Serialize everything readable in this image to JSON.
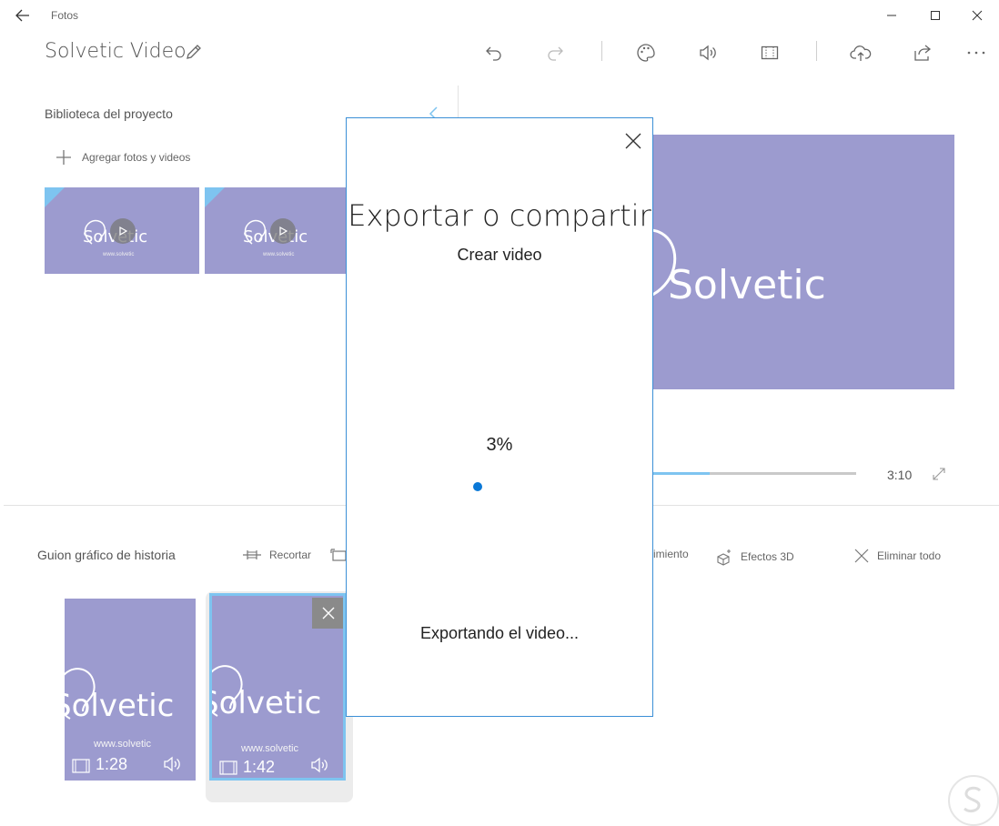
{
  "window": {
    "app_title": "Fotos",
    "back_icon": "arrow-left-icon",
    "minimize_icon": "minimize-icon",
    "maximize_icon": "maximize-icon",
    "close_icon": "close-icon"
  },
  "header": {
    "project_title": "Solvetic Video",
    "toolbar_icons": [
      "undo-icon",
      "redo-icon",
      "palette-icon",
      "volume-icon",
      "aspect-ratio-icon",
      "upload-cloud-icon",
      "share-icon",
      "more-icon"
    ]
  },
  "library": {
    "title": "Biblioteca del proyecto",
    "add_label": "Agregar fotos y videos",
    "items": [
      {
        "logo": "Solvetic",
        "url": "www.solvetic"
      },
      {
        "logo": "Solvetic",
        "url": "www.solvetic"
      }
    ]
  },
  "preview": {
    "logo": "Solvetic",
    "duration": "3:10",
    "progress": 0.28
  },
  "storyboard": {
    "title": "Guion gráfico de historia",
    "tools": {
      "trim": "Recortar",
      "motion": "imiento",
      "effects3d": "Efectos 3D",
      "delete_all": "Eliminar todo"
    },
    "clips": [
      {
        "logo": "Solvetic",
        "url": "www.solvetic",
        "duration": "1:28",
        "selected": false
      },
      {
        "logo": "Solvetic",
        "url": "www.solvetic",
        "duration": "1:42",
        "selected": true
      }
    ]
  },
  "dialog": {
    "title": "Exportar o compartir",
    "subtitle": "Crear video",
    "percent": "3%",
    "status": "Exportando el video..."
  },
  "colors": {
    "accent": "#0a78d7",
    "thumb": "#9c9bcf",
    "highlight": "#7ec4f0"
  }
}
